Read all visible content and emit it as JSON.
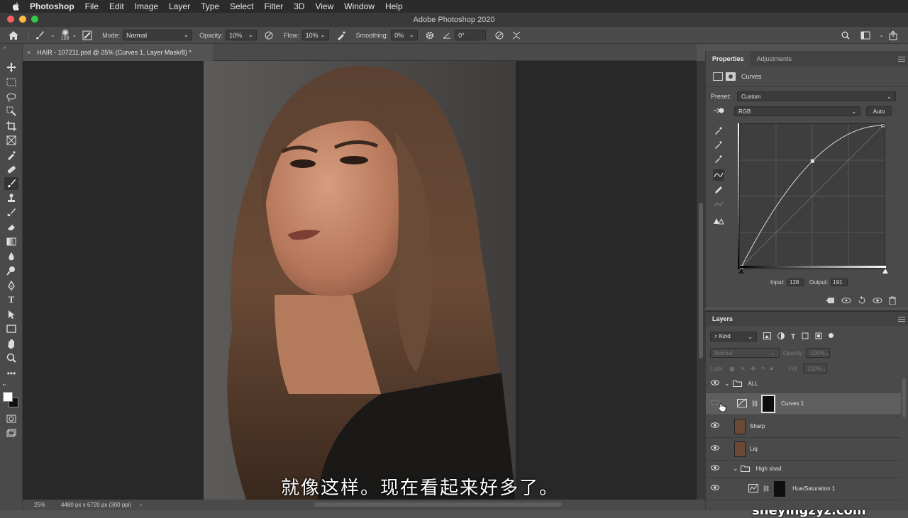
{
  "menubar": {
    "items": [
      "Photoshop",
      "File",
      "Edit",
      "Image",
      "Layer",
      "Type",
      "Select",
      "Filter",
      "3D",
      "View",
      "Window",
      "Help"
    ]
  },
  "window": {
    "title": "Adobe Photoshop 2020"
  },
  "options": {
    "brush_size": "108",
    "mode_label": "Mode:",
    "mode_value": "Normal",
    "opacity_label": "Opacity:",
    "opacity_value": "10%",
    "flow_label": "Flow:",
    "flow_value": "10%",
    "smoothing_label": "Smoothing:",
    "smoothing_value": "0%",
    "angle_value": "0°"
  },
  "document": {
    "tab_title": "HAIR - 107211.psd @ 25% (Curves 1, Layer Mask/8) *",
    "zoom": "25%",
    "dimensions": "4480 px x 6720 px (300 ppi)"
  },
  "subtitle": "就像这样。现在看起来好多了。",
  "watermark": "摄影前沿 sheyingzyz.com",
  "properties": {
    "tab_properties": "Properties",
    "tab_adjustments": "Adjustments",
    "panel_name": "Curves",
    "preset_label": "Preset:",
    "preset_value": "Custom",
    "channel_value": "RGB",
    "auto_label": "Auto",
    "input_label": "Input:",
    "input_value": "128",
    "output_label": "Output:",
    "output_value": "191"
  },
  "layers": {
    "title": "Layers",
    "filter_kind": "Kind",
    "blend_mode": "Normal",
    "opacity_label": "Opacity:",
    "opacity_value": "100%",
    "lock_label": "Lock:",
    "fill_label": "Fill:",
    "fill_value": "100%",
    "rows": [
      {
        "name": "ALL"
      },
      {
        "name": "Curves 1"
      },
      {
        "name": "Sharp"
      },
      {
        "name": "Liq"
      },
      {
        "name": "High shad"
      },
      {
        "name": "Hue/Saturation 1"
      }
    ]
  }
}
